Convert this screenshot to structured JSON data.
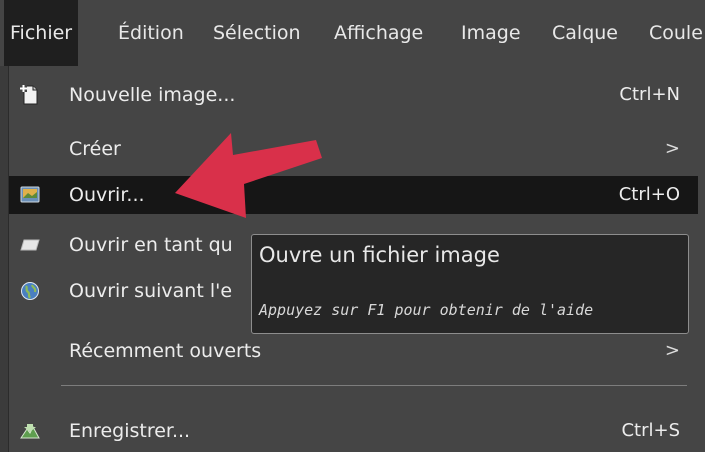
{
  "menubar": {
    "items": [
      "Fichier",
      "Édition",
      "Sélection",
      "Affichage",
      "Image",
      "Calque",
      "Coule"
    ]
  },
  "menu": {
    "items": [
      {
        "label": "Nouvelle image...",
        "shortcut": "Ctrl+N",
        "icon": "new-image-icon"
      },
      {
        "label": "Créer",
        "submenu_glyph": ">"
      },
      {
        "label": "Ouvrir...",
        "shortcut": "Ctrl+O",
        "icon": "open-image-icon",
        "highlighted": true
      },
      {
        "label": "Ouvrir en tant qu",
        "icon": "open-as-layers-icon"
      },
      {
        "label": "Ouvrir suivant l'e",
        "icon": "open-location-icon"
      },
      {
        "label": "Récemment ouverts",
        "submenu_glyph": ">"
      },
      {
        "label": "Enregistrer...",
        "shortcut": "Ctrl+S",
        "icon": "save-icon"
      }
    ]
  },
  "tooltip": {
    "title": "Ouvre un fichier image",
    "help": "Appuyez sur F1 pour obtenir de l'aide"
  },
  "colors": {
    "menubar_bg": "#454545",
    "highlight_bg": "#161616",
    "annotation_arrow": "#d9304a"
  }
}
